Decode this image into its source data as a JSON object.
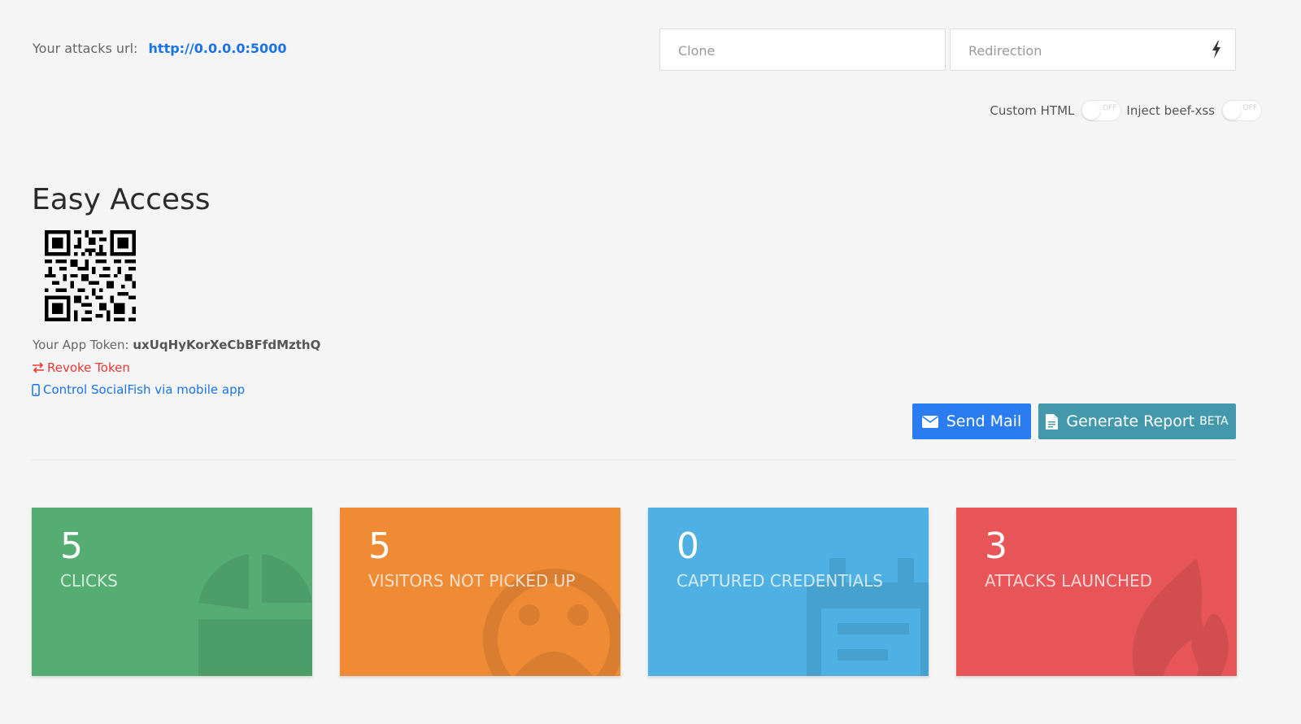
{
  "header": {
    "attack_url_label": "Your attacks url:",
    "attack_url": "http://0.0.0.0:5000",
    "clone_placeholder": "Clone",
    "redirection_placeholder": "Redirection",
    "custom_html_label": "Custom HTML",
    "inject_label": "Inject beef-xss",
    "toggle_off_text": "OFF"
  },
  "easy_access": {
    "title": "Easy Access",
    "token_label": "Your App Token:",
    "token_value": "uxUqHyKorXeCbBFfdMzthQ",
    "revoke_label": "Revoke Token",
    "mobile_label": "Control SocialFish via mobile app"
  },
  "actions": {
    "send_mail_label": "Send Mail",
    "report_label": "Generate Report",
    "report_badge": "BETA"
  },
  "stats": [
    {
      "value": "5",
      "label": "CLICKS",
      "color": "#55ad74",
      "icon": "pie-chart-icon"
    },
    {
      "value": "5",
      "label": "VISITORS NOT PICKED UP",
      "color": "#ef8a35",
      "icon": "sad-face-icon"
    },
    {
      "value": "0",
      "label": "CAPTURED CREDENTIALS",
      "color": "#4fb1e3",
      "icon": "calendar-icon"
    },
    {
      "value": "3",
      "label": "ATTACKS LAUNCHED",
      "color": "#e75558",
      "icon": "fire-icon"
    }
  ],
  "colors": {
    "link_blue": "#1a73e8",
    "danger_red": "#e53935",
    "button_blue": "#2b7cf0",
    "button_teal": "#4399ab"
  }
}
